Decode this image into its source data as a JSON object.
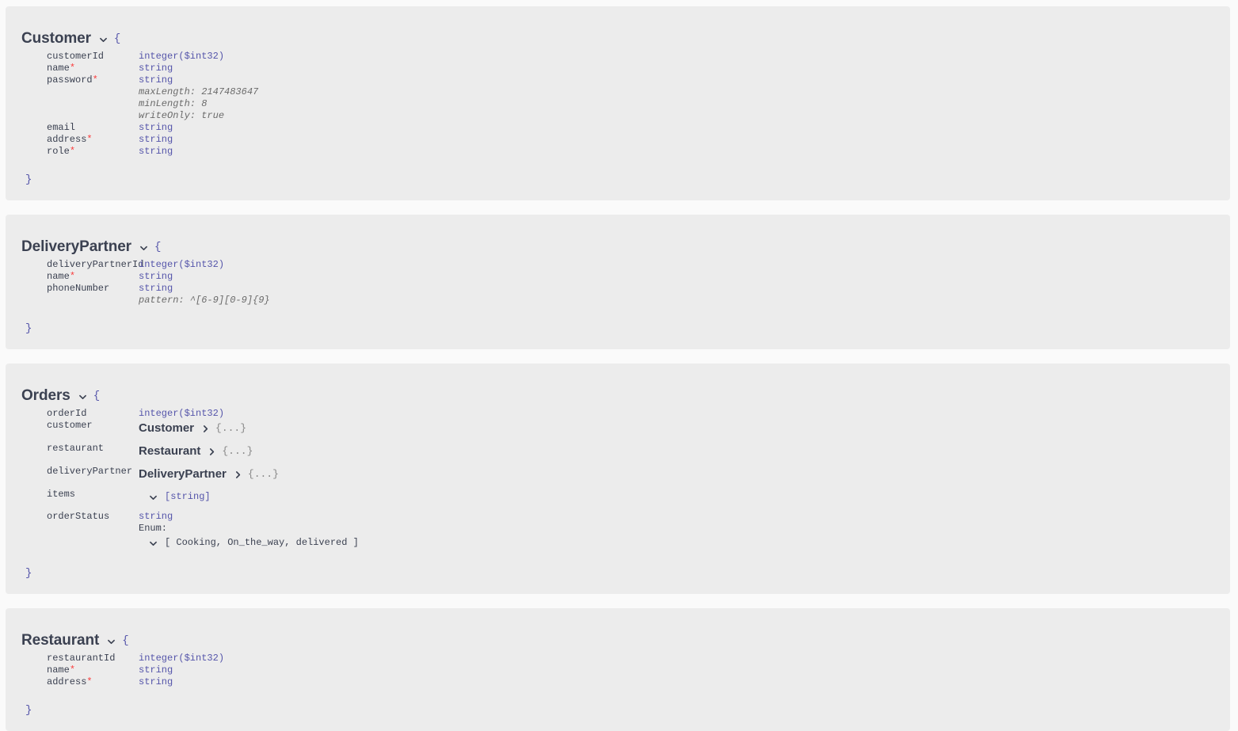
{
  "colors": {
    "page_background": "#fafafa",
    "panel_background": "#ececec",
    "title_text": "#3b4151",
    "type_text": "#55a",
    "required_marker": "#f93e3e",
    "constraint_text": "#6b6b6b",
    "dots_text": "#888888"
  },
  "glyphs": {
    "open_brace": "{",
    "close_brace": "}",
    "collapsed_object": "{...}",
    "required_star": "*",
    "enum_label": "Enum:"
  },
  "models": [
    {
      "name": "Customer",
      "expanded": true,
      "toggle_icon": "chevron-down-icon",
      "properties": [
        {
          "name": "customerId",
          "required": false,
          "type": "integer($int32)",
          "constraints": []
        },
        {
          "name": "name",
          "required": true,
          "type": "string",
          "constraints": []
        },
        {
          "name": "password",
          "required": true,
          "type": "string",
          "constraints": [
            "maxLength: 2147483647",
            "minLength: 8",
            "writeOnly: true"
          ]
        },
        {
          "name": "email",
          "required": false,
          "type": "string",
          "constraints": []
        },
        {
          "name": "address",
          "required": true,
          "type": "string",
          "constraints": []
        },
        {
          "name": "role",
          "required": true,
          "type": "string",
          "constraints": []
        }
      ]
    },
    {
      "name": "DeliveryPartner",
      "expanded": true,
      "toggle_icon": "chevron-down-icon",
      "properties": [
        {
          "name": "deliveryPartnerId",
          "required": false,
          "type": "integer($int32)",
          "constraints": []
        },
        {
          "name": "name",
          "required": true,
          "type": "string",
          "constraints": []
        },
        {
          "name": "phoneNumber",
          "required": false,
          "type": "string",
          "constraints": [
            "pattern: ^[6-9][0-9]{9}"
          ]
        }
      ]
    },
    {
      "name": "Orders",
      "expanded": true,
      "toggle_icon": "chevron-down-icon",
      "properties": [
        {
          "name": "orderId",
          "required": false,
          "type": "integer($int32)",
          "constraints": []
        },
        {
          "name": "customer",
          "required": false,
          "ref_model": "Customer",
          "ref_icon": "chevron-right-icon",
          "ref_collapsed_text": "{...}",
          "constraints": []
        },
        {
          "name": "restaurant",
          "required": false,
          "ref_model": "Restaurant",
          "ref_icon": "chevron-right-icon",
          "ref_collapsed_text": "{...}",
          "constraints": []
        },
        {
          "name": "deliveryPartner",
          "required": false,
          "ref_model": "DeliveryPartner",
          "ref_icon": "chevron-right-icon",
          "ref_collapsed_text": "{...}",
          "constraints": []
        },
        {
          "name": "items",
          "required": false,
          "array_type": "[string]",
          "array_icon": "chevron-down-icon",
          "constraints": []
        },
        {
          "name": "orderStatus",
          "required": false,
          "type": "string",
          "enum_label": "Enum:",
          "enum_icon": "chevron-down-icon",
          "enum_values": "[ Cooking, On_the_way, delivered ]",
          "constraints": []
        }
      ]
    },
    {
      "name": "Restaurant",
      "expanded": true,
      "toggle_icon": "chevron-down-icon",
      "properties": [
        {
          "name": "restaurantId",
          "required": false,
          "type": "integer($int32)",
          "constraints": []
        },
        {
          "name": "name",
          "required": true,
          "type": "string",
          "constraints": []
        },
        {
          "name": "address",
          "required": true,
          "type": "string",
          "constraints": []
        }
      ]
    }
  ]
}
